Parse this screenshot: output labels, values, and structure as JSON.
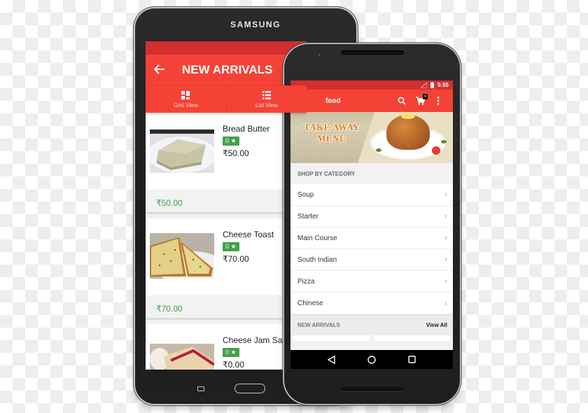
{
  "tablet": {
    "brand": "SAMSUNG",
    "screen": {
      "title": "NEW ARRIVALS",
      "back_icon": "arrow-left",
      "tabs": [
        {
          "label": "Grid View",
          "icon": "grid-icon"
        },
        {
          "label": "List View",
          "icon": "list-icon"
        }
      ],
      "products": [
        {
          "name": "Bread Butter",
          "rating": "0 ★",
          "price": "₹50.00",
          "footer_price": "₹50.00"
        },
        {
          "name": "Cheese Toast",
          "rating": "0 ★",
          "price": "₹70.00",
          "footer_price": "₹70.00"
        },
        {
          "name": "Cheese Jam Sandwich",
          "name_visible": "Cheese Jam San",
          "rating": "0 ★",
          "price": "₹0.00"
        }
      ]
    }
  },
  "phone": {
    "status": {
      "time": "5:55"
    },
    "appbar": {
      "title": "food",
      "cart_count": "0"
    },
    "banner": {
      "line1": "TAKE AWAY",
      "line2": "MENU"
    },
    "shop_by_category_label": "SHOP BY CATEGORY",
    "categories": [
      {
        "label": "Soup"
      },
      {
        "label": "Starter"
      },
      {
        "label": "Main Course"
      },
      {
        "label": "South Indian"
      },
      {
        "label": "Pizza"
      },
      {
        "label": "Chinese"
      }
    ],
    "new_arrivals": {
      "label": "NEW ARRIVALS",
      "view_all": "View All"
    }
  },
  "colors": {
    "primary": "#f44336",
    "primary_dark": "#d32f2f",
    "rating_green": "#43a047",
    "price_green": "#43a047"
  }
}
